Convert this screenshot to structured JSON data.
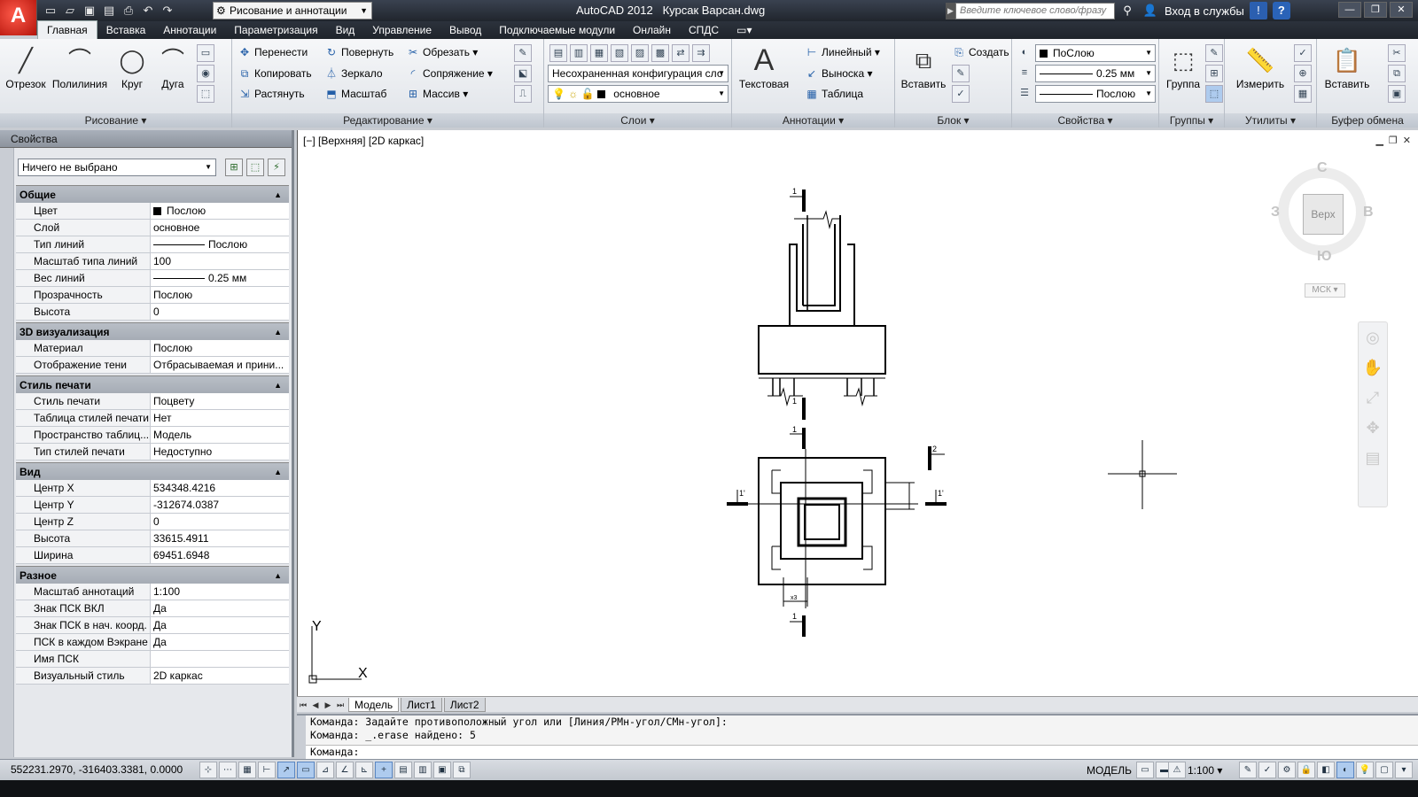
{
  "titlebar": {
    "app_logo": "A",
    "workspace": "Рисование и аннотации",
    "app_name": "AutoCAD 2012",
    "file_name": "Курсак Варсан.dwg",
    "search_placeholder": "Введите ключевое слово/фразу",
    "signin": "Вход в службы",
    "help": "?",
    "qat_icons": [
      "new-icon",
      "open-icon",
      "save-icon",
      "saveas-icon",
      "print-icon",
      "undo-icon",
      "redo-icon"
    ]
  },
  "ribbon_tabs": [
    "Главная",
    "Вставка",
    "Аннотации",
    "Параметризация",
    "Вид",
    "Управление",
    "Вывод",
    "Подключаемые модули",
    "Онлайн",
    "СПДС"
  ],
  "ribbon": {
    "draw": {
      "title": "Рисование",
      "line": "Отрезок",
      "polyline": "Полилиния",
      "circle": "Круг",
      "arc": "Дуга"
    },
    "modify": {
      "title": "Редактирование",
      "move": "Перенести",
      "rotate": "Повернуть",
      "trim": "Обрезать",
      "copy": "Копировать",
      "mirror": "Зеркало",
      "fillet": "Сопряжение",
      "stretch": "Растянуть",
      "scale": "Масштаб",
      "array": "Массив"
    },
    "layers": {
      "title": "Слои",
      "state": "Несохраненная конфигурация сло",
      "current": "основное"
    },
    "annotation": {
      "title": "Аннотации",
      "text": "Текстовая",
      "linear": "Линейный",
      "leader": "Выноска",
      "table": "Таблица"
    },
    "block": {
      "title": "Блок",
      "insert": "Вставить",
      "create": "Создать"
    },
    "properties": {
      "title": "Свойства",
      "color": "ПоСлою",
      "lineweight": "0.25 мм",
      "linetype": "Послою"
    },
    "groups": {
      "title": "Группы",
      "group": "Группа"
    },
    "utilities": {
      "title": "Утилиты",
      "measure": "Измерить"
    },
    "clipboard": {
      "title": "Буфер обмена",
      "paste": "Вставить"
    }
  },
  "properties_palette": {
    "title": "Свойства",
    "selection": "Ничего не выбрано",
    "categories": [
      {
        "name": "Общие",
        "rows": [
          {
            "key": "Цвет",
            "value": "Послою"
          },
          {
            "key": "Слой",
            "value": "основное"
          },
          {
            "key": "Тип линий",
            "value": "Послою"
          },
          {
            "key": "Масштаб типа линий",
            "value": "100"
          },
          {
            "key": "Вес линий",
            "value": "0.25 мм"
          },
          {
            "key": "Прозрачность",
            "value": "Послою"
          },
          {
            "key": "Высота",
            "value": "0"
          }
        ]
      },
      {
        "name": "3D визуализация",
        "rows": [
          {
            "key": "Материал",
            "value": "Послою"
          },
          {
            "key": "Отображение тени",
            "value": "Отбрасываемая и прини..."
          }
        ]
      },
      {
        "name": "Стиль печати",
        "rows": [
          {
            "key": "Стиль печати",
            "value": "Поцвету"
          },
          {
            "key": "Таблица стилей печати",
            "value": "Нет"
          },
          {
            "key": "Пространство таблиц...",
            "value": "Модель"
          },
          {
            "key": "Тип стилей печати",
            "value": "Недоступно"
          }
        ]
      },
      {
        "name": "Вид",
        "rows": [
          {
            "key": "Центр X",
            "value": "534348.4216"
          },
          {
            "key": "Центр Y",
            "value": "-312674.0387"
          },
          {
            "key": "Центр Z",
            "value": "0"
          },
          {
            "key": "Высота",
            "value": "33615.4911"
          },
          {
            "key": "Ширина",
            "value": "69451.6948"
          }
        ]
      },
      {
        "name": "Разное",
        "rows": [
          {
            "key": "Масштаб аннотаций",
            "value": "1:100"
          },
          {
            "key": "Знак ПСК ВКЛ",
            "value": "Да"
          },
          {
            "key": "Знак ПСК в нач. коорд.",
            "value": "Да"
          },
          {
            "key": "ПСК в каждом Вэкране",
            "value": "Да"
          },
          {
            "key": "Имя ПСК",
            "value": ""
          },
          {
            "key": "Визуальный стиль",
            "value": "2D каркас"
          }
        ]
      }
    ]
  },
  "viewport": {
    "label": "[−] [Верхняя] [2D каркас]",
    "viewcube_face": "Верх",
    "dir_n": "С",
    "dir_s": "Ю",
    "dir_w": "З",
    "dir_e": "В",
    "wcs": "МСК",
    "ucs_x": "X",
    "ucs_y": "Y",
    "section_1": "1",
    "section_2": "2",
    "dim_small": "х3",
    "marker_1p": "1'"
  },
  "layout_tabs": [
    "Модель",
    "Лист1",
    "Лист2"
  ],
  "command_line": {
    "line1": "Команда: Задайте противоположный угол или [Линия/РМн-угол/СМн-угол]:",
    "line2": "Команда: _.erase найдено: 5",
    "prompt": "Команда:"
  },
  "statusbar": {
    "coords": "552231.2970, -316403.3381, 0.0000",
    "model": "МОДЕЛЬ",
    "scale": "1:100"
  }
}
